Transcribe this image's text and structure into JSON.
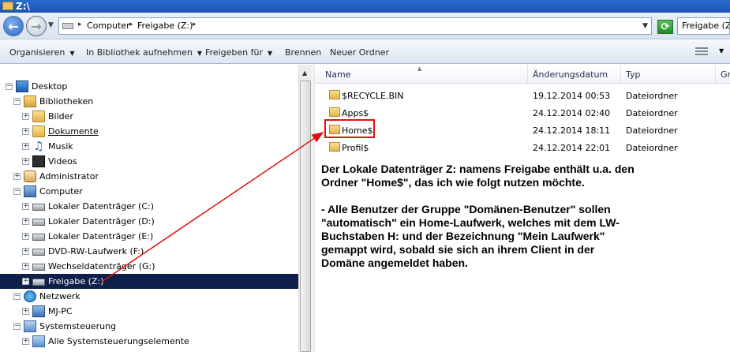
{
  "window": {
    "title": "Z:\\"
  },
  "address": {
    "crumbs": [
      "Computer",
      "Freigabe (Z:)"
    ],
    "search_placeholder": "Freigabe (Z:) durchsuchen"
  },
  "toolbar": {
    "organize": "Organisieren",
    "include_library": "In Bibliothek aufnehmen",
    "share_with": "Freigeben für",
    "burn": "Brennen",
    "new_folder": "Neuer Ordner"
  },
  "tree": [
    {
      "label": "Desktop",
      "expander": "−",
      "icon": "desktop-icon",
      "level": 0
    },
    {
      "label": "Bibliotheken",
      "expander": "−",
      "icon": "library-icon",
      "level": 1
    },
    {
      "label": "Bilder",
      "expander": "+",
      "icon": "pictures-icon",
      "level": 2
    },
    {
      "label": "Dokumente",
      "expander": "+",
      "icon": "documents-icon",
      "level": 2,
      "link": true
    },
    {
      "label": "Musik",
      "expander": "+",
      "icon": "music-icon",
      "level": 2
    },
    {
      "label": "Videos",
      "expander": "+",
      "icon": "videos-icon",
      "level": 2
    },
    {
      "label": "Administrator",
      "expander": "+",
      "icon": "user-folder-icon",
      "level": 1
    },
    {
      "label": "Computer",
      "expander": "−",
      "icon": "computer-icon",
      "level": 1
    },
    {
      "label": "Lokaler Datenträger (C:)",
      "expander": "+",
      "icon": "drive-icon",
      "level": 2
    },
    {
      "label": "Lokaler Datenträger (D:)",
      "expander": "+",
      "icon": "drive-icon",
      "level": 2
    },
    {
      "label": "Lokaler Datenträger (E:)",
      "expander": "+",
      "icon": "drive-icon",
      "level": 2
    },
    {
      "label": "DVD-RW-Laufwerk (F:)",
      "expander": "+",
      "icon": "dvd-drive-icon",
      "level": 2
    },
    {
      "label": "Wechseldatenträger (G:)",
      "expander": "+",
      "icon": "removable-drive-icon",
      "level": 2
    },
    {
      "label": "Freigabe (Z:)",
      "expander": "+",
      "icon": "network-drive-icon",
      "level": 2,
      "selected": true
    },
    {
      "label": "Netzwerk",
      "expander": "−",
      "icon": "network-icon",
      "level": 1
    },
    {
      "label": "MJ-PC",
      "expander": "+",
      "icon": "computer-icon",
      "level": 2
    },
    {
      "label": "Systemsteuerung",
      "expander": "−",
      "icon": "control-panel-icon",
      "level": 1
    },
    {
      "label": "Alle Systemsteuerungselemente",
      "expander": "+",
      "icon": "control-panel-icon",
      "level": 2
    }
  ],
  "columns": {
    "name": "Name",
    "date": "Änderungsdatum",
    "type": "Typ",
    "size": "Gr"
  },
  "files": [
    {
      "name": "$RECYCLE.BIN",
      "date": "19.12.2014 00:53",
      "type": "Dateiordner"
    },
    {
      "name": "Apps$",
      "date": "24.12.2014 02:40",
      "type": "Dateiordner"
    },
    {
      "name": "Home$",
      "date": "24.12.2014 18:11",
      "type": "Dateiordner"
    },
    {
      "name": "Profil$",
      "date": "24.12.2014 22:01",
      "type": "Dateiordner"
    }
  ],
  "annotation": {
    "paragraph1": "Der Lokale Datenträger Z: namens Freigabe enthält u.a. den\nOrdner \"Home$\", das ich wie folgt nutzen möchte.",
    "paragraph2": "- Alle Benutzer der Gruppe \"Domänen-Benutzer\" sollen\n\"automatisch\" ein Home-Laufwerk, welches mit dem LW-\nBuchstaben H: und der Bezeichnung \"Mein Laufwerk\"\ngemappt wird, sobald sie sich an ihrem Client in der\nDomäne angemeldet haben."
  },
  "colors": {
    "highlight": "#e01010",
    "selection": "#0e1f4a",
    "arrow": "#e01010"
  }
}
